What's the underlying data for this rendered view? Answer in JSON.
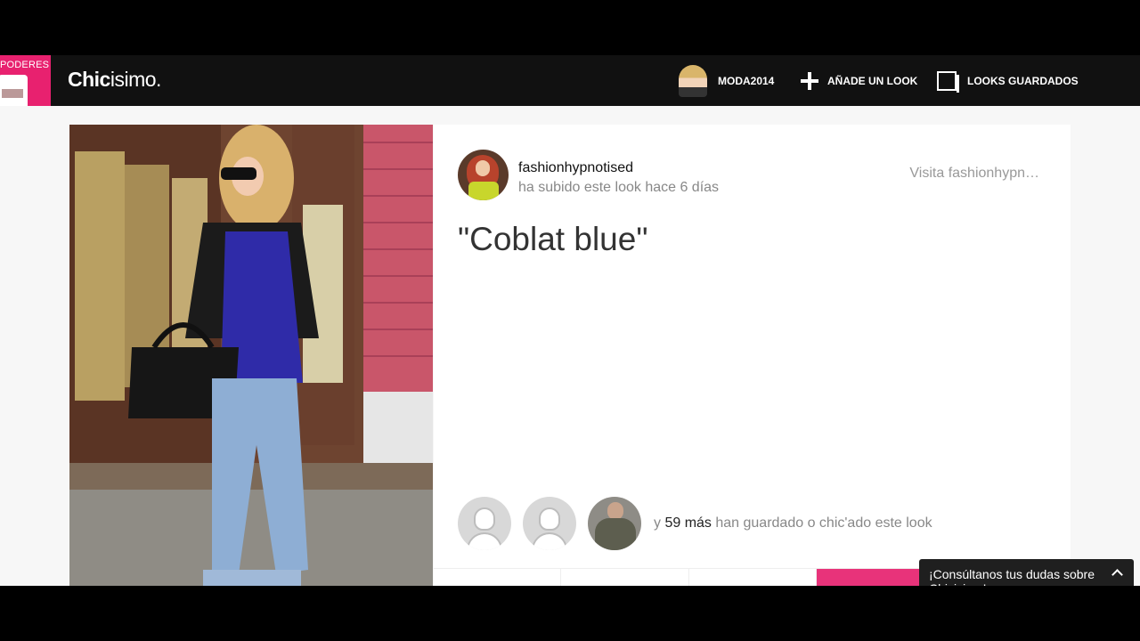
{
  "nav": {
    "promo_text": "PODERES",
    "logo_bold": "Chic",
    "logo_rest": "isimo.",
    "user_label": "MODA2014",
    "add_label": "AÑADE UN LOOK",
    "saved_label": "LOOKS GUARDADOS"
  },
  "look": {
    "uploader": "fashionhypnotised",
    "upload_meta": "ha subido este look hace 6 días",
    "visit_link": "Visita fashionhypn…",
    "title": "\"Coblat blue\""
  },
  "savers": {
    "prefix": "y ",
    "count": "59 más",
    "suffix": " han guardado o chic'ado este look"
  },
  "chat": {
    "label": "¡Consúltanos tus dudas sobre Chicisimo!"
  },
  "colors": {
    "brand_pink": "#e8216f",
    "nav_bg": "#111111"
  }
}
